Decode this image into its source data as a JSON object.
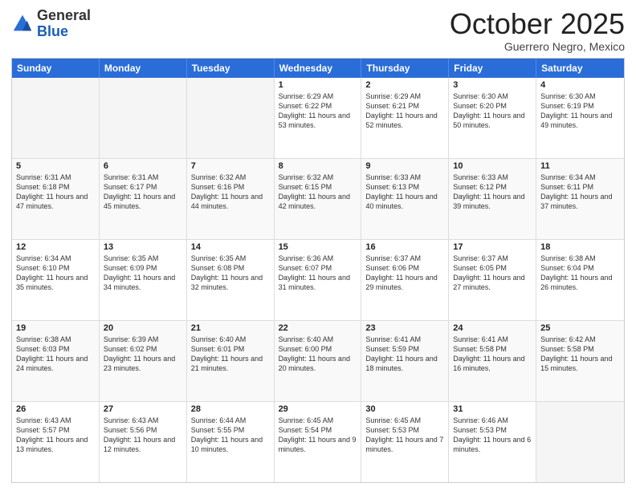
{
  "logo": {
    "general": "General",
    "blue": "Blue"
  },
  "title": "October 2025",
  "location": "Guerrero Negro, Mexico",
  "weekdays": [
    "Sunday",
    "Monday",
    "Tuesday",
    "Wednesday",
    "Thursday",
    "Friday",
    "Saturday"
  ],
  "rows": [
    [
      {
        "day": "",
        "info": ""
      },
      {
        "day": "",
        "info": ""
      },
      {
        "day": "",
        "info": ""
      },
      {
        "day": "1",
        "info": "Sunrise: 6:29 AM\nSunset: 6:22 PM\nDaylight: 11 hours and 53 minutes."
      },
      {
        "day": "2",
        "info": "Sunrise: 6:29 AM\nSunset: 6:21 PM\nDaylight: 11 hours and 52 minutes."
      },
      {
        "day": "3",
        "info": "Sunrise: 6:30 AM\nSunset: 6:20 PM\nDaylight: 11 hours and 50 minutes."
      },
      {
        "day": "4",
        "info": "Sunrise: 6:30 AM\nSunset: 6:19 PM\nDaylight: 11 hours and 49 minutes."
      }
    ],
    [
      {
        "day": "5",
        "info": "Sunrise: 6:31 AM\nSunset: 6:18 PM\nDaylight: 11 hours and 47 minutes."
      },
      {
        "day": "6",
        "info": "Sunrise: 6:31 AM\nSunset: 6:17 PM\nDaylight: 11 hours and 45 minutes."
      },
      {
        "day": "7",
        "info": "Sunrise: 6:32 AM\nSunset: 6:16 PM\nDaylight: 11 hours and 44 minutes."
      },
      {
        "day": "8",
        "info": "Sunrise: 6:32 AM\nSunset: 6:15 PM\nDaylight: 11 hours and 42 minutes."
      },
      {
        "day": "9",
        "info": "Sunrise: 6:33 AM\nSunset: 6:13 PM\nDaylight: 11 hours and 40 minutes."
      },
      {
        "day": "10",
        "info": "Sunrise: 6:33 AM\nSunset: 6:12 PM\nDaylight: 11 hours and 39 minutes."
      },
      {
        "day": "11",
        "info": "Sunrise: 6:34 AM\nSunset: 6:11 PM\nDaylight: 11 hours and 37 minutes."
      }
    ],
    [
      {
        "day": "12",
        "info": "Sunrise: 6:34 AM\nSunset: 6:10 PM\nDaylight: 11 hours and 35 minutes."
      },
      {
        "day": "13",
        "info": "Sunrise: 6:35 AM\nSunset: 6:09 PM\nDaylight: 11 hours and 34 minutes."
      },
      {
        "day": "14",
        "info": "Sunrise: 6:35 AM\nSunset: 6:08 PM\nDaylight: 11 hours and 32 minutes."
      },
      {
        "day": "15",
        "info": "Sunrise: 6:36 AM\nSunset: 6:07 PM\nDaylight: 11 hours and 31 minutes."
      },
      {
        "day": "16",
        "info": "Sunrise: 6:37 AM\nSunset: 6:06 PM\nDaylight: 11 hours and 29 minutes."
      },
      {
        "day": "17",
        "info": "Sunrise: 6:37 AM\nSunset: 6:05 PM\nDaylight: 11 hours and 27 minutes."
      },
      {
        "day": "18",
        "info": "Sunrise: 6:38 AM\nSunset: 6:04 PM\nDaylight: 11 hours and 26 minutes."
      }
    ],
    [
      {
        "day": "19",
        "info": "Sunrise: 6:38 AM\nSunset: 6:03 PM\nDaylight: 11 hours and 24 minutes."
      },
      {
        "day": "20",
        "info": "Sunrise: 6:39 AM\nSunset: 6:02 PM\nDaylight: 11 hours and 23 minutes."
      },
      {
        "day": "21",
        "info": "Sunrise: 6:40 AM\nSunset: 6:01 PM\nDaylight: 11 hours and 21 minutes."
      },
      {
        "day": "22",
        "info": "Sunrise: 6:40 AM\nSunset: 6:00 PM\nDaylight: 11 hours and 20 minutes."
      },
      {
        "day": "23",
        "info": "Sunrise: 6:41 AM\nSunset: 5:59 PM\nDaylight: 11 hours and 18 minutes."
      },
      {
        "day": "24",
        "info": "Sunrise: 6:41 AM\nSunset: 5:58 PM\nDaylight: 11 hours and 16 minutes."
      },
      {
        "day": "25",
        "info": "Sunrise: 6:42 AM\nSunset: 5:58 PM\nDaylight: 11 hours and 15 minutes."
      }
    ],
    [
      {
        "day": "26",
        "info": "Sunrise: 6:43 AM\nSunset: 5:57 PM\nDaylight: 11 hours and 13 minutes."
      },
      {
        "day": "27",
        "info": "Sunrise: 6:43 AM\nSunset: 5:56 PM\nDaylight: 11 hours and 12 minutes."
      },
      {
        "day": "28",
        "info": "Sunrise: 6:44 AM\nSunset: 5:55 PM\nDaylight: 11 hours and 10 minutes."
      },
      {
        "day": "29",
        "info": "Sunrise: 6:45 AM\nSunset: 5:54 PM\nDaylight: 11 hours and 9 minutes."
      },
      {
        "day": "30",
        "info": "Sunrise: 6:45 AM\nSunset: 5:53 PM\nDaylight: 11 hours and 7 minutes."
      },
      {
        "day": "31",
        "info": "Sunrise: 6:46 AM\nSunset: 5:53 PM\nDaylight: 11 hours and 6 minutes."
      },
      {
        "day": "",
        "info": ""
      }
    ]
  ]
}
